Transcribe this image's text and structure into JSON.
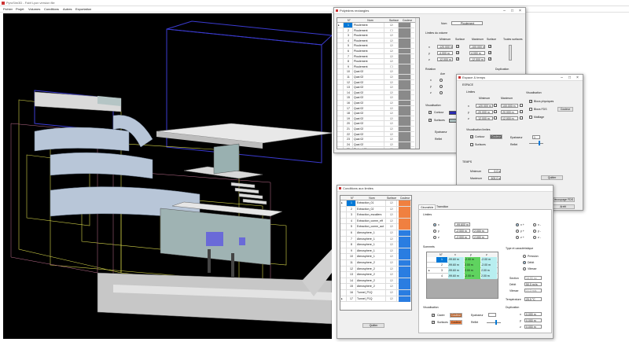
{
  "app": {
    "title": "PyroSim3D - Fabf Lyon version file",
    "menu": [
      "Fichier",
      "Projet",
      "Volumes",
      "Conditions",
      "Autres",
      "Exportation"
    ]
  },
  "win_volumes": {
    "title": "Polyèdres rectangles",
    "col_n": "N°",
    "col_nom": "Nom",
    "col_surface": "Surface",
    "col_couleur": "Couleur",
    "rows": [
      {
        "n": "1",
        "nom": "Ploulement",
        "s": true
      },
      {
        "n": "2",
        "nom": "Ploulement",
        "s": false
      },
      {
        "n": "3",
        "nom": "Ploulement",
        "s": true
      },
      {
        "n": "4",
        "nom": "Ploulement",
        "s": true
      },
      {
        "n": "5",
        "nom": "Ploulement",
        "s": true
      },
      {
        "n": "6",
        "nom": "Ploulement",
        "s": true
      },
      {
        "n": "7",
        "nom": "Ploulement",
        "s": true
      },
      {
        "n": "8",
        "nom": "Ploulement",
        "s": true
      },
      {
        "n": "9",
        "nom": "Ploulement",
        "s": false
      },
      {
        "n": "10",
        "nom": "Quai 02",
        "s": true
      },
      {
        "n": "11",
        "nom": "Quai 02",
        "s": true
      },
      {
        "n": "12",
        "nom": "Quai 02",
        "s": true
      },
      {
        "n": "13",
        "nom": "Quai 02",
        "s": true
      },
      {
        "n": "14",
        "nom": "Quai 02",
        "s": true
      },
      {
        "n": "15",
        "nom": "Quai 02",
        "s": true
      },
      {
        "n": "16",
        "nom": "Quai 02",
        "s": true
      },
      {
        "n": "17",
        "nom": "Quai 02",
        "s": true
      },
      {
        "n": "18",
        "nom": "Quai 02",
        "s": true
      },
      {
        "n": "19",
        "nom": "Quai 02",
        "s": true
      },
      {
        "n": "20",
        "nom": "Quai 02",
        "s": true
      },
      {
        "n": "21",
        "nom": "Quai 02",
        "s": true
      },
      {
        "n": "22",
        "nom": "Quai 02",
        "s": true
      },
      {
        "n": "23",
        "nom": "Quai 02",
        "s": true
      },
      {
        "n": "24",
        "nom": "Quai 02",
        "s": true
      },
      {
        "n": "25",
        "nom": "Plafond 01",
        "s": true
      }
    ],
    "nom_label": "Nom",
    "nom_value": "Ploulement",
    "limites_label": "Limites du volume",
    "min_label": "Minimum",
    "surf_label": "Surface",
    "max_label": "Maximum",
    "toutes_label": "Toutes surfaces",
    "axes": [
      "x",
      "y",
      "z"
    ],
    "mins": [
      "-120.000 m",
      "-4.000 m",
      "-12.000 m"
    ],
    "maxs": [
      "-100.000 m",
      "4.000 m",
      "-12.000 m"
    ],
    "rotation_label": "Rotation",
    "axe_label": "Axe",
    "coord_label": "Coordonnées",
    "angle_label": "Angle",
    "duplication_label": "Duplication",
    "visu_label": "Visualisation",
    "contour_label": "Contour",
    "surfaces_label": "Surfaces",
    "epaisseur_label": "Epaisseur",
    "reflet_label": "Reflet"
  },
  "win_espace": {
    "title": "Espace & temps",
    "espace_label": "ESPACE",
    "limites_label": "Limites",
    "min_label": "Minimum",
    "max_label": "Maximum",
    "axes": [
      "x",
      "y",
      "z"
    ],
    "mins": [
      "-120.000 m",
      "-20.000 m",
      "-12.000 m"
    ],
    "maxs": [
      "100.000 m",
      "20.000 m",
      "12.000 m"
    ],
    "visu_label": "Visualisation",
    "blocs_physiques": "Blocs physiques",
    "blocs_fds": "Blocs FDS",
    "maillage": "Maillage",
    "couleur_btn": "Couleur",
    "visu_limites_label": "Visualisation limites",
    "contour_label": "Contour",
    "couleur_label": "Couleur",
    "surfaces_label": "Surfaces",
    "epaisseur_label": "Epaisseur",
    "epaisseur_value": "1",
    "reflet_label": "Reflet",
    "temps_label": "TEMPS",
    "t_min_label": "Minimum",
    "t_min": "0.0 s",
    "t_max_label": "Maximum",
    "t_max": "600.0 s",
    "quitter": "Quitter",
    "decoupage_label": "Découpage en blocs FDS",
    "dim_label": "Dimension caractéristique des blocs FDS",
    "dim_value": "0.100 m",
    "type_volume_label": "Type volume",
    "decoupage_btn": "Découpage FDS",
    "annuler_btn": "Arrêt"
  },
  "win_conditions": {
    "title": "Conditions aux limites",
    "col_n": "N°",
    "col_nom": "Nom",
    "col_surface": "Surface",
    "col_couleur": "Couleur",
    "rows": [
      {
        "n": "1",
        "nom": "Extraction_01",
        "s": true,
        "c": "#f08040"
      },
      {
        "n": "2",
        "nom": "Extraction_02",
        "s": true,
        "c": "#f08040"
      },
      {
        "n": "3",
        "nom": "Extraction_escaliers",
        "s": true,
        "c": "#f08040"
      },
      {
        "n": "4",
        "nom": "Extraction_comm_eff",
        "s": true,
        "c": "#f08040"
      },
      {
        "n": "5",
        "nom": "Extraction_comm_aut",
        "s": true,
        "c": "#f08040"
      },
      {
        "n": "6",
        "nom": "Atmosphere_1",
        "s": true,
        "c": "#2a7de1"
      },
      {
        "n": "7",
        "nom": "Atmosphere_1",
        "s": true,
        "c": "#2a7de1"
      },
      {
        "n": "8",
        "nom": "Atmosphere_1",
        "s": true,
        "c": "#2a7de1"
      },
      {
        "n": "9",
        "nom": "Atmosphere_1",
        "s": true,
        "c": "#2a7de1"
      },
      {
        "n": "10",
        "nom": "Atmosphere_1",
        "s": true,
        "c": "#2a7de1"
      },
      {
        "n": "11",
        "nom": "Atmosphere_2",
        "s": true,
        "c": "#2a7de1"
      },
      {
        "n": "12",
        "nom": "Atmosphere_2",
        "s": true,
        "c": "#2a7de1"
      },
      {
        "n": "13",
        "nom": "Atmosphere_2",
        "s": true,
        "c": "#2a7de1"
      },
      {
        "n": "14",
        "nom": "Atmosphere_2",
        "s": true,
        "c": "#2a7de1"
      },
      {
        "n": "15",
        "nom": "Atmosphere_2",
        "s": true,
        "c": "#2a7de1"
      },
      {
        "n": "16",
        "nom": "Tunnel_P1Q",
        "s": true,
        "c": "#2a7de1"
      },
      {
        "n": "17",
        "nom": "Tunnel_P1Q",
        "s": true,
        "c": "#2a7de1"
      }
    ],
    "quitter": "Quitter",
    "tabs": [
      "Géométrie",
      "Transition"
    ],
    "limites_label": "Limites",
    "axes": [
      "x",
      "y",
      "z"
    ],
    "mins": [
      "-99.600 m",
      "-2.000 m",
      "-2.000 m"
    ],
    "maxs": [
      "-99.600 m",
      "2.000 m",
      "2.000 m"
    ],
    "plus_minus": [
      "x +",
      "x -",
      "y +",
      "y -",
      "z +",
      "z -"
    ],
    "sommets_label": "Sommets",
    "sommets_cols": [
      "N°",
      "x",
      "y",
      "z"
    ],
    "sommets": [
      [
        "1",
        "-99.60 m",
        "-2.00 m",
        "-2.00 m"
      ],
      [
        "2",
        "-99.60 m",
        "2.00 m",
        "-2.00 m"
      ],
      [
        "3",
        "-99.60 m",
        "2.00 m",
        "2.00 m"
      ],
      [
        "4",
        "-99.60 m",
        "-2.00 m",
        "2.00 m"
      ]
    ],
    "type_label": "Type et caractéristique",
    "type_options": [
      "Pression",
      "Débit",
      "Vitesse"
    ],
    "section_label": "Section",
    "section_value": "16.00 m²",
    "debit_label": "Débit",
    "debit_value": "50.0 m³/s",
    "vitesse_label": "Vitesse",
    "vitesse_value": "3.13 m/s",
    "temperature_label": "Température",
    "temperature_value": "20.0 °C",
    "visu_label": "Visualisation",
    "cadre_label": "Cadre",
    "surfaces_label": "Surfaces",
    "couleur_label": "Couleur",
    "epaisseur_label": "Epaisseur",
    "reflet_label": "Reflet",
    "duplication_label": "Duplication",
    "dup_axes": [
      "x",
      "y",
      "z"
    ],
    "dup_values": [
      "0.000 m",
      "0.000 m",
      "0.000 m"
    ]
  },
  "colors": {
    "viewport_bg": "#000000",
    "selection_blue": "#0078d7",
    "accent_orange": "#f08040",
    "accent_blue": "#2a7de1",
    "green_cell": "#5fd35f",
    "cyan_cell": "#b8eef0"
  }
}
